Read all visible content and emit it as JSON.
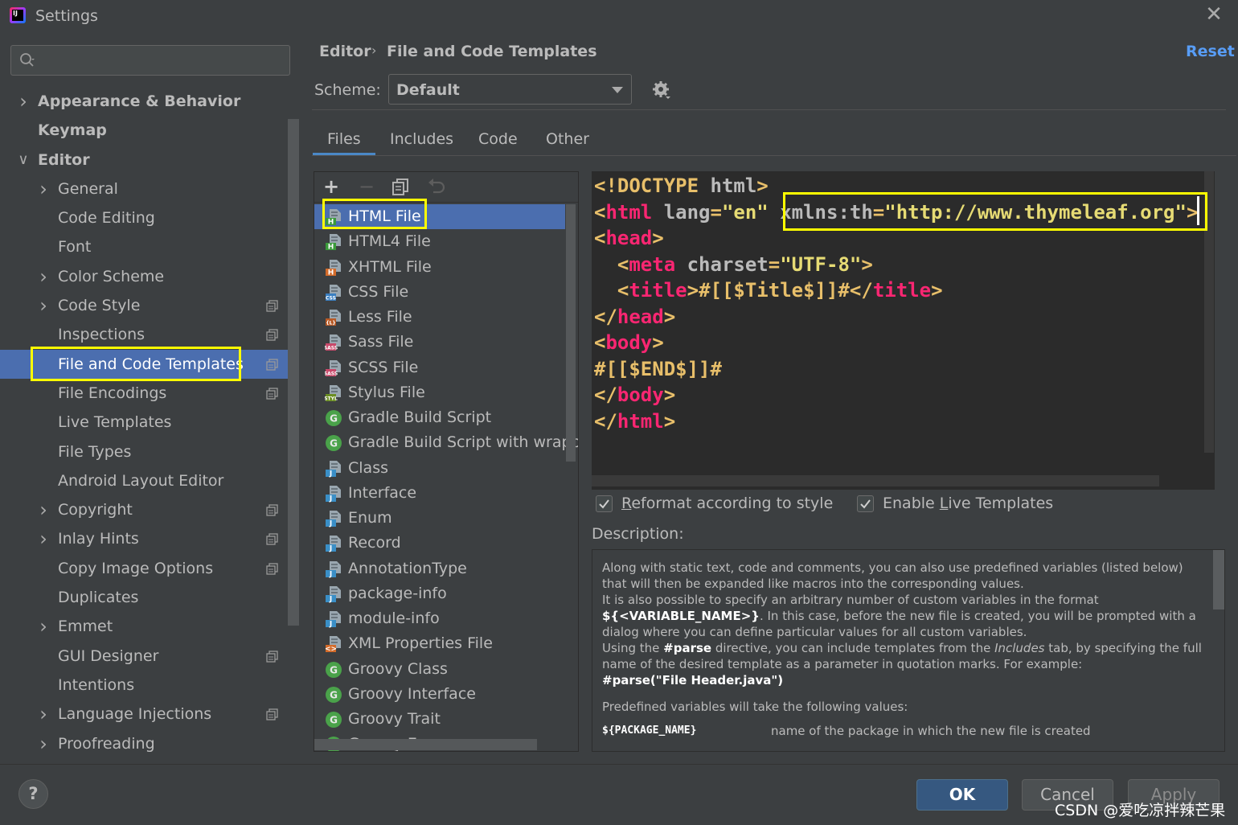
{
  "window": {
    "title": "Settings"
  },
  "search": {
    "placeholder": ""
  },
  "sidebar": {
    "items": [
      {
        "label": "Appearance & Behavior",
        "level": 0,
        "expandable": true,
        "expanded": false,
        "copy_icon": false
      },
      {
        "label": "Keymap",
        "level": 0,
        "expandable": false,
        "copy_icon": false
      },
      {
        "label": "Editor",
        "level": 0,
        "expandable": true,
        "expanded": true,
        "copy_icon": false
      },
      {
        "label": "General",
        "level": 1,
        "expandable": true,
        "copy_icon": false
      },
      {
        "label": "Code Editing",
        "level": 1,
        "expandable": false,
        "copy_icon": false
      },
      {
        "label": "Font",
        "level": 1,
        "expandable": false,
        "copy_icon": false
      },
      {
        "label": "Color Scheme",
        "level": 1,
        "expandable": true,
        "copy_icon": false
      },
      {
        "label": "Code Style",
        "level": 1,
        "expandable": true,
        "copy_icon": true
      },
      {
        "label": "Inspections",
        "level": 1,
        "expandable": false,
        "copy_icon": true
      },
      {
        "label": "File and Code Templates",
        "level": 1,
        "expandable": false,
        "copy_icon": true,
        "selected": true
      },
      {
        "label": "File Encodings",
        "level": 1,
        "expandable": false,
        "copy_icon": true
      },
      {
        "label": "Live Templates",
        "level": 1,
        "expandable": false,
        "copy_icon": false
      },
      {
        "label": "File Types",
        "level": 1,
        "expandable": false,
        "copy_icon": false
      },
      {
        "label": "Android Layout Editor",
        "level": 1,
        "expandable": false,
        "copy_icon": false
      },
      {
        "label": "Copyright",
        "level": 1,
        "expandable": true,
        "copy_icon": true
      },
      {
        "label": "Inlay Hints",
        "level": 1,
        "expandable": true,
        "copy_icon": true
      },
      {
        "label": "Copy Image Options",
        "level": 1,
        "expandable": false,
        "copy_icon": true
      },
      {
        "label": "Duplicates",
        "level": 1,
        "expandable": false,
        "copy_icon": false
      },
      {
        "label": "Emmet",
        "level": 1,
        "expandable": true,
        "copy_icon": false
      },
      {
        "label": "GUI Designer",
        "level": 1,
        "expandable": false,
        "copy_icon": true
      },
      {
        "label": "Intentions",
        "level": 1,
        "expandable": false,
        "copy_icon": false
      },
      {
        "label": "Language Injections",
        "level": 1,
        "expandable": true,
        "copy_icon": true
      },
      {
        "label": "Proofreading",
        "level": 1,
        "expandable": true,
        "copy_icon": false
      }
    ]
  },
  "breadcrumb": {
    "parent": "Editor",
    "separator": "›",
    "current": "File and Code Templates"
  },
  "reset_label": "Reset",
  "scheme": {
    "label": "Scheme:",
    "value": "Default"
  },
  "tabs": [
    {
      "label": "Files",
      "active": true
    },
    {
      "label": "Includes",
      "active": false
    },
    {
      "label": "Code",
      "active": false
    },
    {
      "label": "Other",
      "active": false
    }
  ],
  "toolbar": {
    "add": "+",
    "remove": "−"
  },
  "files": [
    {
      "name": "HTML File",
      "icon": "html-file-icon",
      "badge": "H",
      "badge_color": "#3a9a3a",
      "selected": true
    },
    {
      "name": "HTML4 File",
      "icon": "html-file-icon",
      "badge": "H",
      "badge_color": "#3a9a3a"
    },
    {
      "name": "XHTML File",
      "icon": "xhtml-file-icon",
      "badge": "H",
      "badge_color": "#d36b2a"
    },
    {
      "name": "CSS File",
      "icon": "css-file-icon",
      "badge": "CSS",
      "badge_color": "#3a7fc1"
    },
    {
      "name": "Less File",
      "icon": "less-file-icon",
      "badge": "{L}",
      "badge_color": "#b85a26"
    },
    {
      "name": "Sass File",
      "icon": "sass-file-icon",
      "badge": "SASS",
      "badge_color": "#c8496a"
    },
    {
      "name": "SCSS File",
      "icon": "scss-file-icon",
      "badge": "SASS",
      "badge_color": "#c8496a"
    },
    {
      "name": "Stylus File",
      "icon": "stylus-file-icon",
      "badge": "STYL",
      "badge_color": "#6b8e23"
    },
    {
      "name": "Gradle Build Script",
      "icon": "gradle-icon",
      "badge": "G",
      "badge_color": "#4aa24a",
      "round": true
    },
    {
      "name": "Gradle Build Script with wrapper",
      "icon": "gradle-icon",
      "badge": "G",
      "badge_color": "#4aa24a",
      "round": true
    },
    {
      "name": "Class",
      "icon": "java-file-icon",
      "badge": "J",
      "badge_color": "#3a8fc7"
    },
    {
      "name": "Interface",
      "icon": "java-file-icon",
      "badge": "J",
      "badge_color": "#3a8fc7"
    },
    {
      "name": "Enum",
      "icon": "java-file-icon",
      "badge": "J",
      "badge_color": "#3a8fc7"
    },
    {
      "name": "Record",
      "icon": "java-file-icon",
      "badge": "J",
      "badge_color": "#3a8fc7"
    },
    {
      "name": "AnnotationType",
      "icon": "java-file-icon",
      "badge": "J",
      "badge_color": "#3a8fc7"
    },
    {
      "name": "package-info",
      "icon": "java-file-icon",
      "badge": "J",
      "badge_color": "#3a8fc7"
    },
    {
      "name": "module-info",
      "icon": "java-file-icon",
      "badge": "J",
      "badge_color": "#3a8fc7"
    },
    {
      "name": "XML Properties File",
      "icon": "xml-file-icon",
      "badge": "<>",
      "badge_color": "#d36b2a"
    },
    {
      "name": "Groovy Class",
      "icon": "groovy-icon",
      "badge": "G",
      "badge_color": "#4aa24a",
      "round": true
    },
    {
      "name": "Groovy Interface",
      "icon": "groovy-icon",
      "badge": "G",
      "badge_color": "#4aa24a",
      "round": true
    },
    {
      "name": "Groovy Trait",
      "icon": "groovy-icon",
      "badge": "G",
      "badge_color": "#4aa24a",
      "round": true
    },
    {
      "name": "Groovy Enum",
      "icon": "groovy-icon",
      "badge": "G",
      "badge_color": "#4aa24a",
      "round": true
    }
  ],
  "editor": {
    "lines": [
      "<!DOCTYPE html>",
      "<html lang=\"en\" xmlns:th=\"http://www.thymeleaf.org\">",
      "<head>",
      "  <meta charset=\"UTF-8\">",
      "  <title>#[[$Title$]]#</title>",
      "</head>",
      "<body>",
      "#[[$END$]]#",
      "</body>",
      "</html>"
    ]
  },
  "options": {
    "reformat": {
      "label_pre": "",
      "label_mnemonic": "R",
      "label_post": "eformat according to style",
      "checked": true
    },
    "live_templates": {
      "label_pre": "Enable ",
      "label_mnemonic": "L",
      "label_post": "ive Templates",
      "checked": true
    }
  },
  "description": {
    "label": "Description:",
    "p1": "Along with static text, code and comments, you can also use predefined variables (listed below) that will then be expanded like macros into the corresponding values.",
    "p2a": "It is also possible to specify an arbitrary number of custom variables in the format ",
    "p2code": "${<VARIABLE_NAME>}",
    "p2b": ". In this case, before the new file is created, you will be prompted with a dialog where you can define particular values for all custom variables.",
    "p3a": "Using the ",
    "p3code": "#parse",
    "p3b": " directive, you can include templates from the ",
    "p3em": "Includes",
    "p3c": " tab, by specifying the full name of the desired template as a parameter in quotation marks. For example:",
    "p3ex": "#parse(\"File Header.java\")",
    "p4": "Predefined variables will take the following values:",
    "var_key": "${PACKAGE_NAME}",
    "var_val": "name of the package in which the new file is created"
  },
  "buttons": {
    "help": "?",
    "ok": "OK",
    "cancel": "Cancel",
    "apply": "Apply"
  },
  "watermark": "CSDN @爱吃凉拌辣芒果",
  "colors": {
    "selection": "#4b6eaf",
    "link": "#589df6",
    "highlight_box": "#ffff00",
    "tag_name": "#f92672",
    "string": "#e6db74"
  }
}
